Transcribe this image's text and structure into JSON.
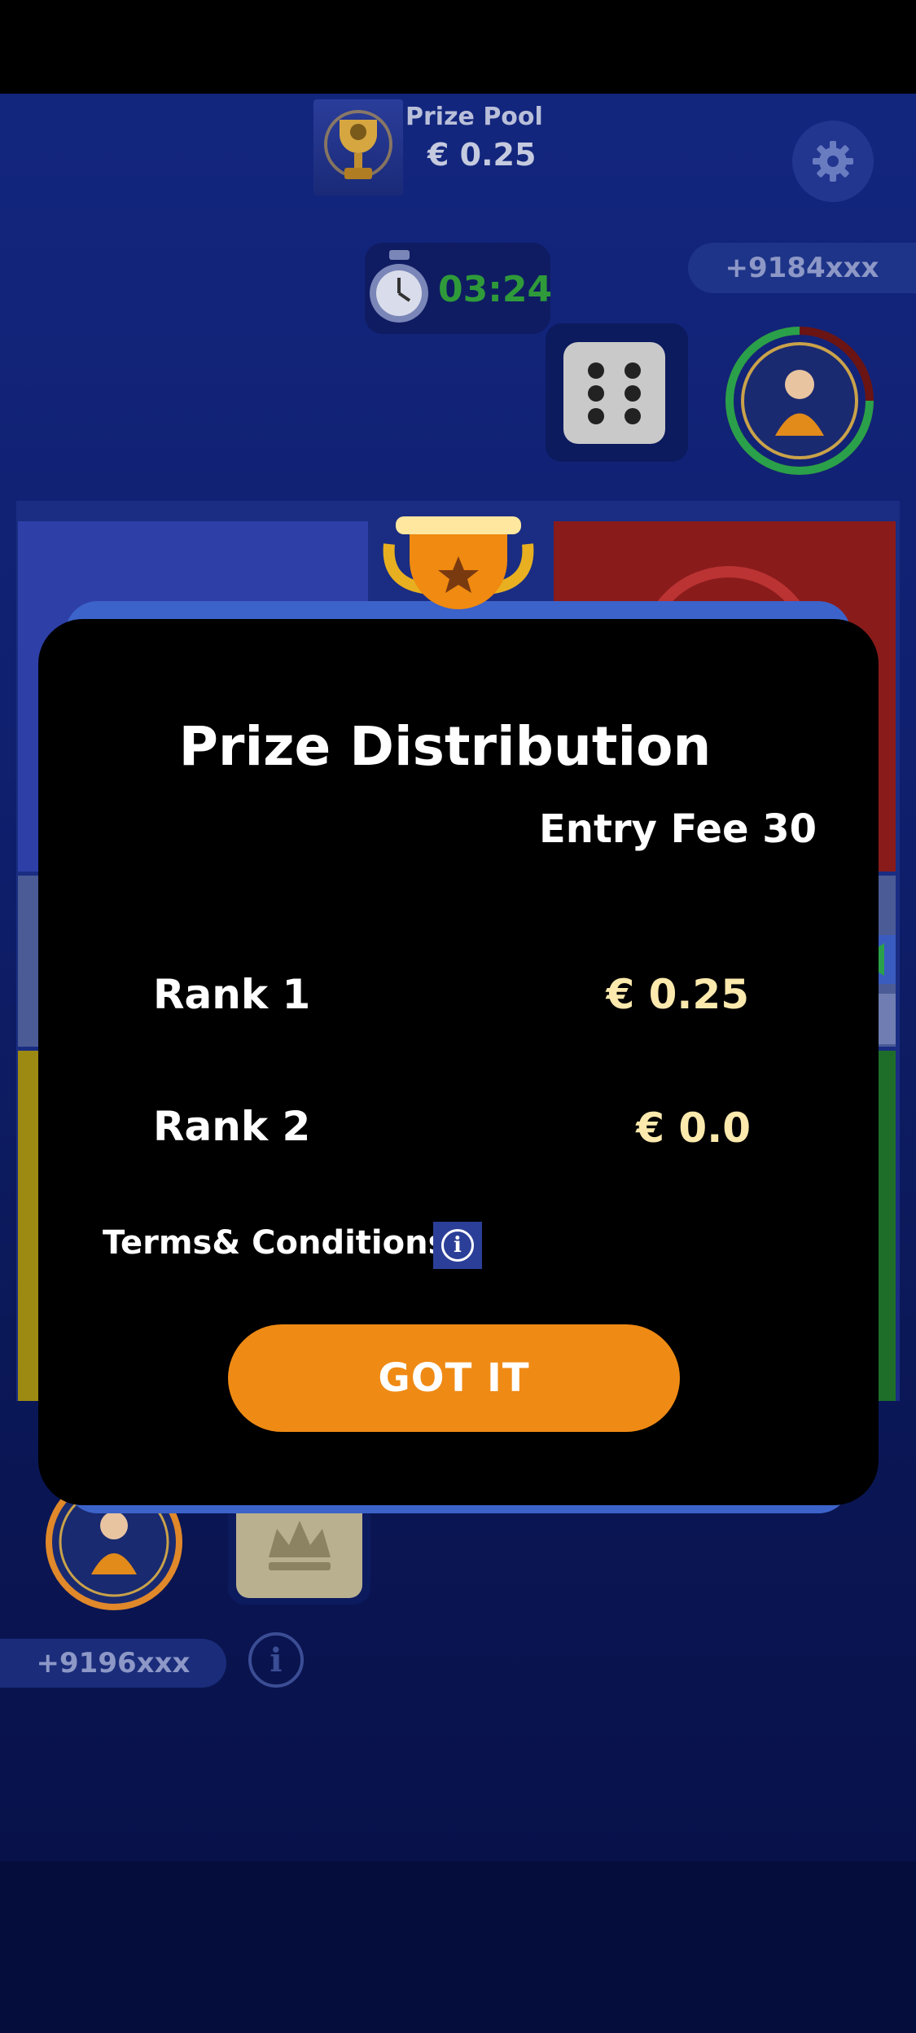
{
  "header": {
    "prize_pool_label": "Prize Pool",
    "prize_pool_value": "€ 0.25",
    "timer": "03:24"
  },
  "players": {
    "top_phone": "+9184xxx",
    "bottom_phone": "+9196xxx"
  },
  "dialog": {
    "title": "Prize Distribution",
    "entry_fee": "Entry Fee 30",
    "ranks": [
      {
        "label": "Rank 1",
        "value": "€ 0.25"
      },
      {
        "label": "Rank 2",
        "value": "€ 0.0"
      }
    ],
    "terms_label": "Terms& Conditions",
    "got_it_label": "GOT IT"
  },
  "icons": {
    "settings": "gear-icon",
    "timer": "stopwatch-icon",
    "trophy": "trophy-icon",
    "info": "info-icon",
    "dice": "dice-icon",
    "crown": "crown-icon"
  },
  "colors": {
    "accent_button": "#ef8a14",
    "rank_value": "#fbe9ad",
    "timer_green": "#2f9a3a",
    "dialog_bg": "#000000",
    "dialog_frame": "#3c63c9"
  }
}
